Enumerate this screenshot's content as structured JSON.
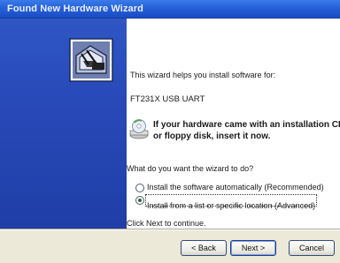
{
  "window": {
    "title": "Found New Hardware Wizard"
  },
  "sidepanel": {
    "icon": "hardware-wizard-icon"
  },
  "main": {
    "intro": "This wizard helps you install software for:",
    "device_name": "FT231X USB UART",
    "cd_icon": "cd-drive-icon",
    "cd_line1": "If your hardware came with an installation CD",
    "cd_line2": "or floppy disk, insert it now.",
    "question": "What do you want the wizard to do?",
    "options": [
      {
        "label": "Install the software automatically (Recommended)",
        "selected": false
      },
      {
        "label": "Install from a list or specific location (Advanced)",
        "selected": true
      }
    ],
    "continue_text": "Click Next to continue."
  },
  "buttons": {
    "back_label": "< Back",
    "next_label": "Next >",
    "cancel_label": "Cancel"
  },
  "colors": {
    "titlebar": "#2560d8",
    "sidepanel": "#2849b8",
    "dialog_bg": "#ece9d8"
  }
}
